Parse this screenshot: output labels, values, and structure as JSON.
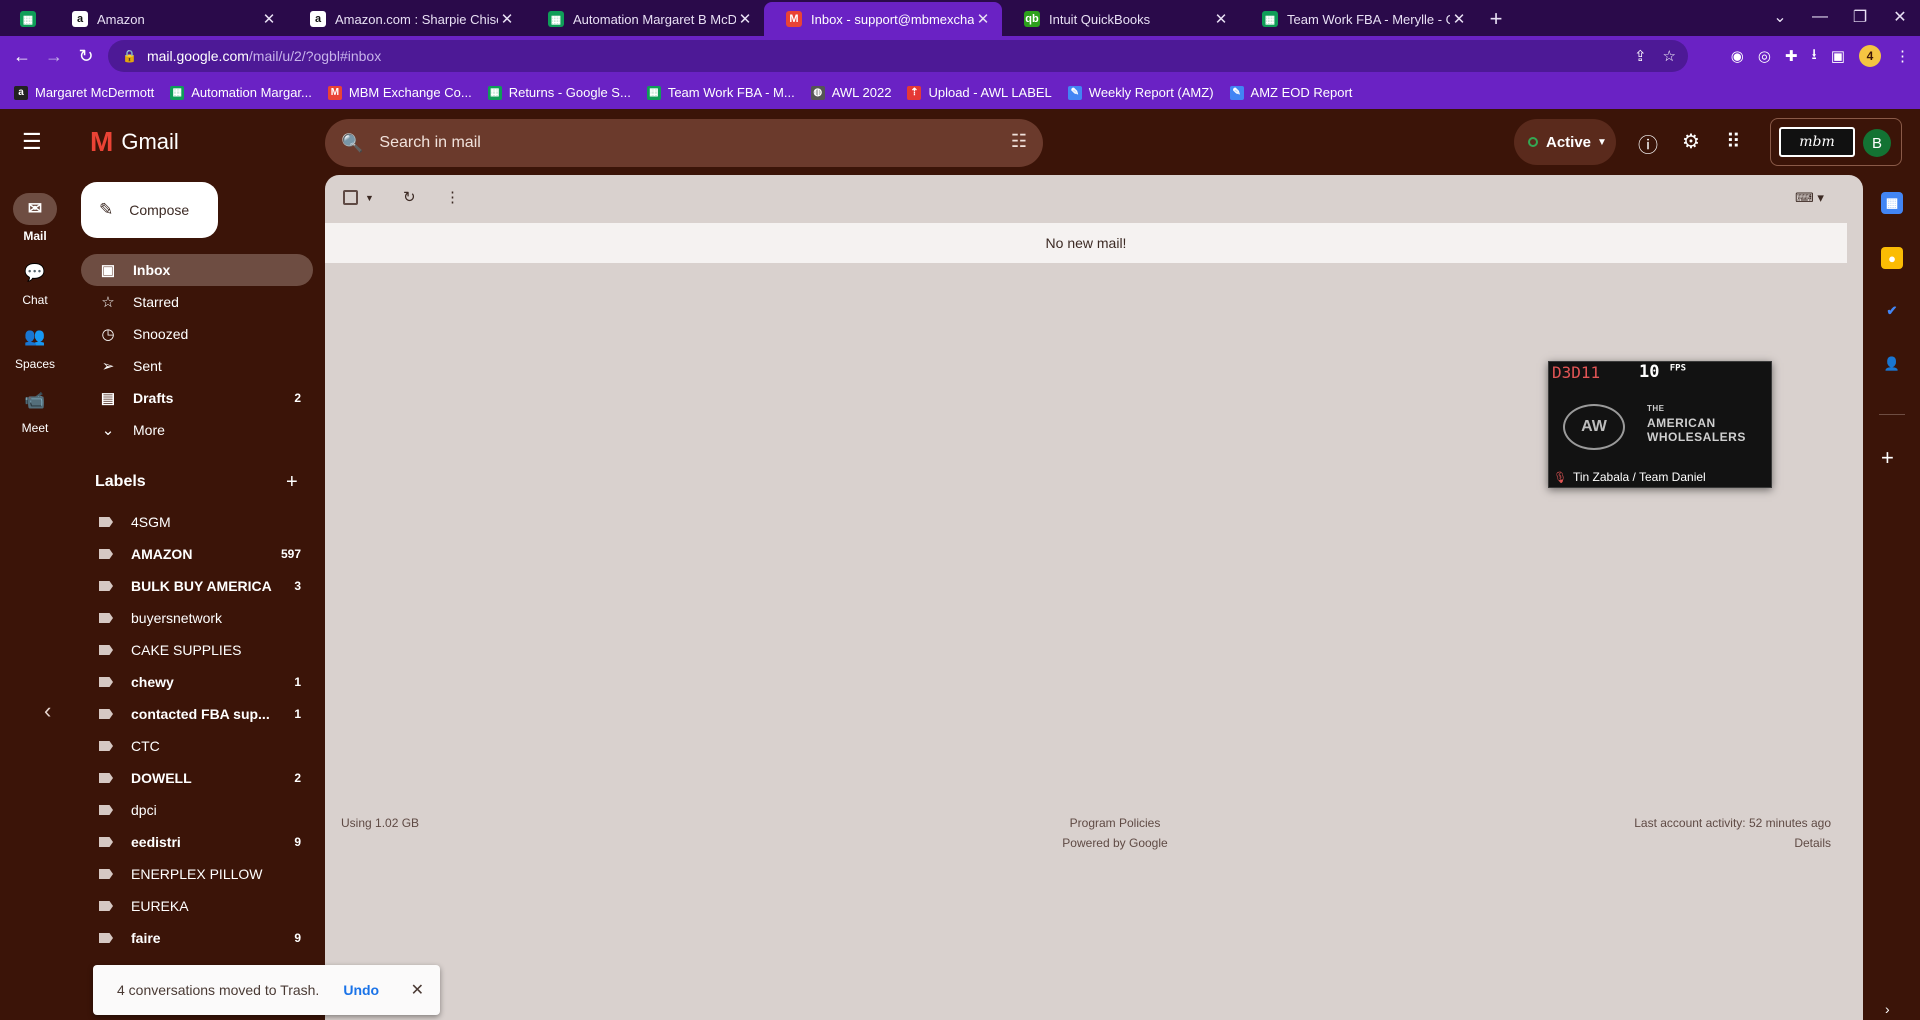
{
  "browser": {
    "tabs": [
      {
        "title": "",
        "icon": "sheets-icon",
        "color": "#0f9d58"
      },
      {
        "title": "Amazon",
        "icon": "amazon-icon",
        "color": "#ffffff"
      },
      {
        "title": "Amazon.com : Sharpie Chisel Tip",
        "icon": "amazon-icon",
        "color": "#ffffff"
      },
      {
        "title": "Automation Margaret B McDerm",
        "icon": "sheets-icon",
        "color": "#0f9d58"
      },
      {
        "title": "Inbox - support@mbmexchange",
        "icon": "gmail-icon",
        "color": "#ea4335"
      },
      {
        "title": "Intuit QuickBooks",
        "icon": "quickbooks-icon",
        "color": "#2ca01c"
      },
      {
        "title": "Team Work FBA - Merylle - Goog",
        "icon": "sheets-icon",
        "color": "#0f9d58"
      }
    ],
    "url_host": "mail.google.com",
    "url_path": "/mail/u/2/?ogbl#inbox",
    "profile_initial": "4",
    "bookmarks": [
      {
        "label": "Margaret McDermott",
        "icon": "amazon-icon",
        "color": "#222222"
      },
      {
        "label": "Automation Margar...",
        "icon": "sheets-icon",
        "color": "#0f9d58"
      },
      {
        "label": "MBM Exchange Co...",
        "icon": "gmail-icon",
        "color": "#ea4335"
      },
      {
        "label": "Returns - Google S...",
        "icon": "sheets-icon",
        "color": "#0f9d58"
      },
      {
        "label": "Team Work FBA - M...",
        "icon": "sheets-icon",
        "color": "#0f9d58"
      },
      {
        "label": "AWL 2022",
        "icon": "globe-icon",
        "color": "#555555"
      },
      {
        "label": "Upload - AWL LABEL",
        "icon": "upload-icon",
        "color": "#e53935"
      },
      {
        "label": "Weekly Report (AMZ)",
        "icon": "pen-icon",
        "color": "#4285f4"
      },
      {
        "label": "AMZ EOD Report",
        "icon": "pen-icon",
        "color": "#4285f4"
      }
    ]
  },
  "gmail": {
    "logo_text": "Gmail",
    "search_placeholder": "Search in mail",
    "status_label": "Active",
    "account_initial": "B",
    "account_logo_text": "mbm",
    "rail": [
      {
        "label": "Mail",
        "icon": "mail-icon",
        "selected": true
      },
      {
        "label": "Chat",
        "icon": "chat-icon",
        "selected": false
      },
      {
        "label": "Spaces",
        "icon": "spaces-icon",
        "selected": false
      },
      {
        "label": "Meet",
        "icon": "meet-icon",
        "selected": false
      }
    ],
    "compose_label": "Compose",
    "nav": [
      {
        "label": "Inbox",
        "icon": "inbox-icon",
        "count": "",
        "selected": true,
        "bold": true
      },
      {
        "label": "Starred",
        "icon": "star-icon",
        "count": "",
        "selected": false,
        "bold": false
      },
      {
        "label": "Snoozed",
        "icon": "clock-icon",
        "count": "",
        "selected": false,
        "bold": false
      },
      {
        "label": "Sent",
        "icon": "send-icon",
        "count": "",
        "selected": false,
        "bold": false
      },
      {
        "label": "Drafts",
        "icon": "draft-icon",
        "count": "2",
        "selected": false,
        "bold": true
      },
      {
        "label": "More",
        "icon": "chevron-down-icon",
        "count": "",
        "selected": false,
        "bold": false
      }
    ],
    "labels_heading": "Labels",
    "labels": [
      {
        "label": "4SGM",
        "count": "",
        "bold": false
      },
      {
        "label": "AMAZON",
        "count": "597",
        "bold": true
      },
      {
        "label": "BULK BUY AMERICA",
        "count": "3",
        "bold": true
      },
      {
        "label": "buyersnetwork",
        "count": "",
        "bold": false
      },
      {
        "label": "CAKE SUPPLIES",
        "count": "",
        "bold": false
      },
      {
        "label": "chewy",
        "count": "1",
        "bold": true
      },
      {
        "label": "contacted FBA sup...",
        "count": "1",
        "bold": true
      },
      {
        "label": "CTC",
        "count": "",
        "bold": false
      },
      {
        "label": "DOWELL",
        "count": "2",
        "bold": true
      },
      {
        "label": "dpci",
        "count": "",
        "bold": false
      },
      {
        "label": "eedistri",
        "count": "9",
        "bold": true
      },
      {
        "label": "ENERPLEX PILLOW",
        "count": "",
        "bold": false
      },
      {
        "label": "EUREKA",
        "count": "",
        "bold": false
      },
      {
        "label": "faire",
        "count": "9",
        "bold": true
      }
    ],
    "no_mail_text": "No new mail!",
    "footer": {
      "storage": "Using 1.02 GB",
      "policies": "Program Policies",
      "powered": "Powered by Google",
      "activity": "Last account activity: 52 minutes ago",
      "details": "Details"
    },
    "snackbar": {
      "message": "4 conversations moved to Trash.",
      "action": "Undo"
    }
  },
  "video_overlay": {
    "code": "D3D11",
    "fps_value": "10",
    "fps_unit": "FPS",
    "emblem": "AW",
    "brand_line1": "THE",
    "brand_line2": "AMERICAN",
    "brand_line3": "WHOLESALERS",
    "participant": "Tin Zabala / Team Daniel"
  },
  "colors": {
    "theme_bg": "#3b1408",
    "chrome_purple": "#6a22c4",
    "main_panel": "#d9d1ce"
  }
}
